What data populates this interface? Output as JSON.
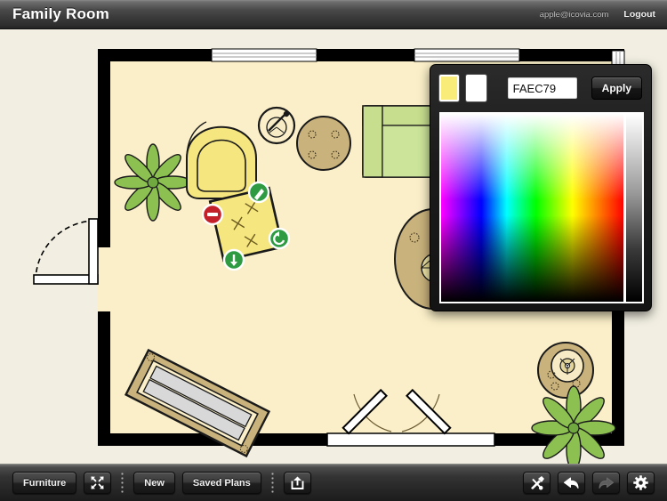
{
  "header": {
    "title": "Family Room",
    "user_email": "apple@icovia.com",
    "logout_label": "Logout"
  },
  "toolbar": {
    "furniture_label": "Furniture",
    "fullscreen_icon": "expand-arrows-icon",
    "new_label": "New",
    "saved_plans_label": "Saved Plans",
    "share_icon": "share-export-icon",
    "tools_icon": "hammer-screwdriver-icon",
    "undo_icon": "undo-arrow-icon",
    "redo_icon": "redo-arrow-icon",
    "settings_icon": "gear-icon"
  },
  "color_picker": {
    "current_swatch": "#FAEC79",
    "alt_swatch": "#FFFFFF",
    "hex_value": "FAEC79",
    "hex_placeholder": "FAEC79",
    "apply_label": "Apply"
  },
  "plan": {
    "floor_color": "#FAEFC8",
    "wall_color": "#000000",
    "page_background": "#F2EFE2",
    "selected_item": {
      "name": "ottoman",
      "color": "#FAEC79",
      "handles": [
        {
          "name": "delete-handle",
          "icon": "minus-icon",
          "color": "#C4202A"
        },
        {
          "name": "paint-handle",
          "icon": "brush-icon",
          "color": "#2E9B43"
        },
        {
          "name": "rotate-handle",
          "icon": "rotate-icon",
          "color": "#2E9B43"
        },
        {
          "name": "resize-handle",
          "icon": "down-arrow-icon",
          "color": "#2E9B43"
        }
      ]
    },
    "items": [
      {
        "name": "armchair",
        "color": "#F5E67F"
      },
      {
        "name": "plant-left",
        "color": "#8CC152"
      },
      {
        "name": "plant-bottom-right",
        "color": "#8CC152"
      },
      {
        "name": "floor-lamp",
        "color": "#FAEFC8"
      },
      {
        "name": "round-table-top",
        "color": "#C9B27C"
      },
      {
        "name": "green-sofa",
        "color": "#C6DE8E"
      },
      {
        "name": "oval-table",
        "color": "#C9B27C"
      },
      {
        "name": "bench-sofa",
        "color": "#C9B27C"
      },
      {
        "name": "side-table-lamp",
        "color": "#C9B27C"
      }
    ],
    "openings": [
      {
        "name": "door-left-wall",
        "type": "single-door"
      },
      {
        "name": "french-door-bottom",
        "type": "double-door"
      },
      {
        "name": "window-top-left",
        "type": "window"
      },
      {
        "name": "window-top-right",
        "type": "window"
      },
      {
        "name": "window-right-wall",
        "type": "window"
      },
      {
        "name": "window-bottom",
        "type": "window"
      }
    ]
  }
}
